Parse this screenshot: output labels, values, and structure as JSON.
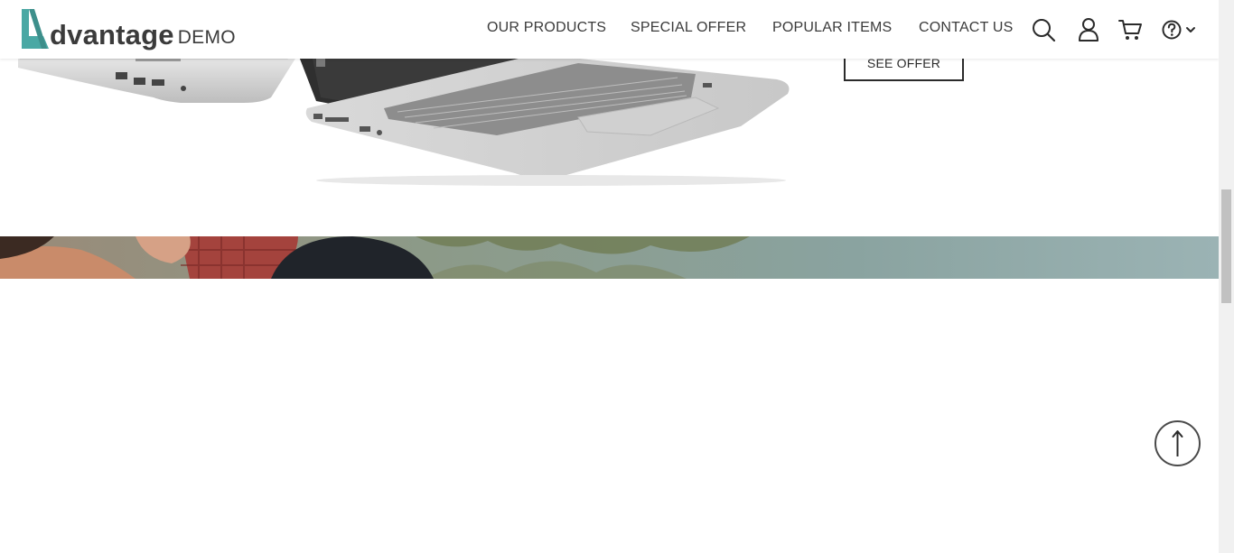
{
  "logo": {
    "word": "dvantage",
    "demo": "DEMO",
    "accent_color": "#4aa8a4"
  },
  "nav": {
    "items": [
      {
        "label": "OUR PRODUCTS"
      },
      {
        "label": "SPECIAL OFFER"
      },
      {
        "label": "POPULAR ITEMS"
      },
      {
        "label": "CONTACT US"
      }
    ],
    "icons": [
      "search-icon",
      "user-icon",
      "cart-icon",
      "help-icon",
      "chevron-down-icon"
    ]
  },
  "hero": {
    "see_offer_label": "SEE OFFER"
  },
  "back_to_top": {
    "icon": "arrow-up-icon"
  }
}
